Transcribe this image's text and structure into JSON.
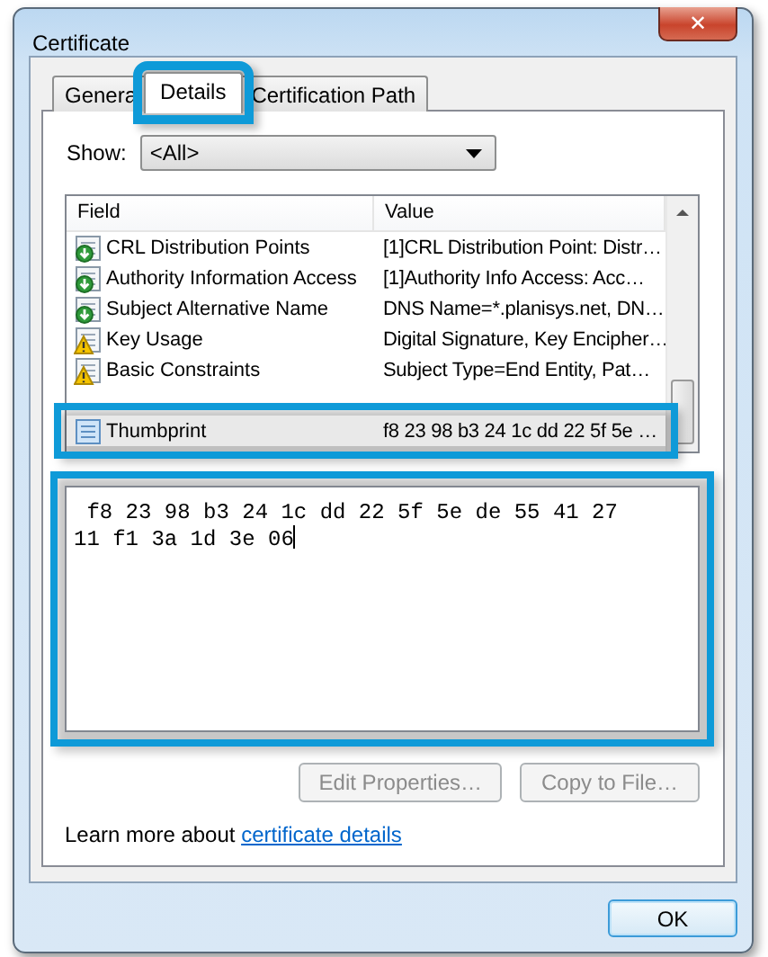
{
  "window": {
    "title": "Certificate",
    "close_label": "✕"
  },
  "tabs": [
    {
      "label": "Genera",
      "selected": false,
      "highlighted": false
    },
    {
      "label": "Details",
      "selected": true,
      "highlighted": true
    },
    {
      "label": "Certification Path",
      "selected": false,
      "highlighted": false
    }
  ],
  "show": {
    "label": "Show:",
    "value": "<All>"
  },
  "table": {
    "columns": [
      "Field",
      "Value"
    ],
    "rows": [
      {
        "kind": "extension",
        "field": "CRL Distribution Points",
        "value": "[1]CRL Distribution Point: Distr…",
        "selected": false,
        "highlighted": false
      },
      {
        "kind": "extension",
        "field": "Authority Information Access",
        "value": "[1]Authority Info Access: Acc…",
        "selected": false,
        "highlighted": false
      },
      {
        "kind": "extension",
        "field": "Subject Alternative Name",
        "value": "DNS Name=*.planisys.net, DN…",
        "selected": false,
        "highlighted": false
      },
      {
        "kind": "critical",
        "field": "Key Usage",
        "value": "Digital Signature, Key Encipher…",
        "selected": false,
        "highlighted": false
      },
      {
        "kind": "critical",
        "field": "Basic Constraints",
        "value": "Subject Type=End Entity, Pat…",
        "selected": false,
        "highlighted": false
      },
      {
        "kind": "property",
        "field": "Thumbprint",
        "value": "f8 23 98 b3 24 1c dd 22 5f 5e …",
        "selected": true,
        "highlighted": true
      }
    ]
  },
  "detail": {
    "value": " f8 23 98 b3 24 1c dd 22 5f 5e de 55 41 27\n11 f1 3a 1d 3e 06",
    "highlighted": true
  },
  "buttons": [
    {
      "label": "Edit Properties…",
      "disabled": true
    },
    {
      "label": "Copy to File…",
      "disabled": true
    }
  ],
  "learn_more": {
    "text": "Learn more about ",
    "link": "certificate details"
  },
  "ok_button": {
    "label": "OK"
  }
}
